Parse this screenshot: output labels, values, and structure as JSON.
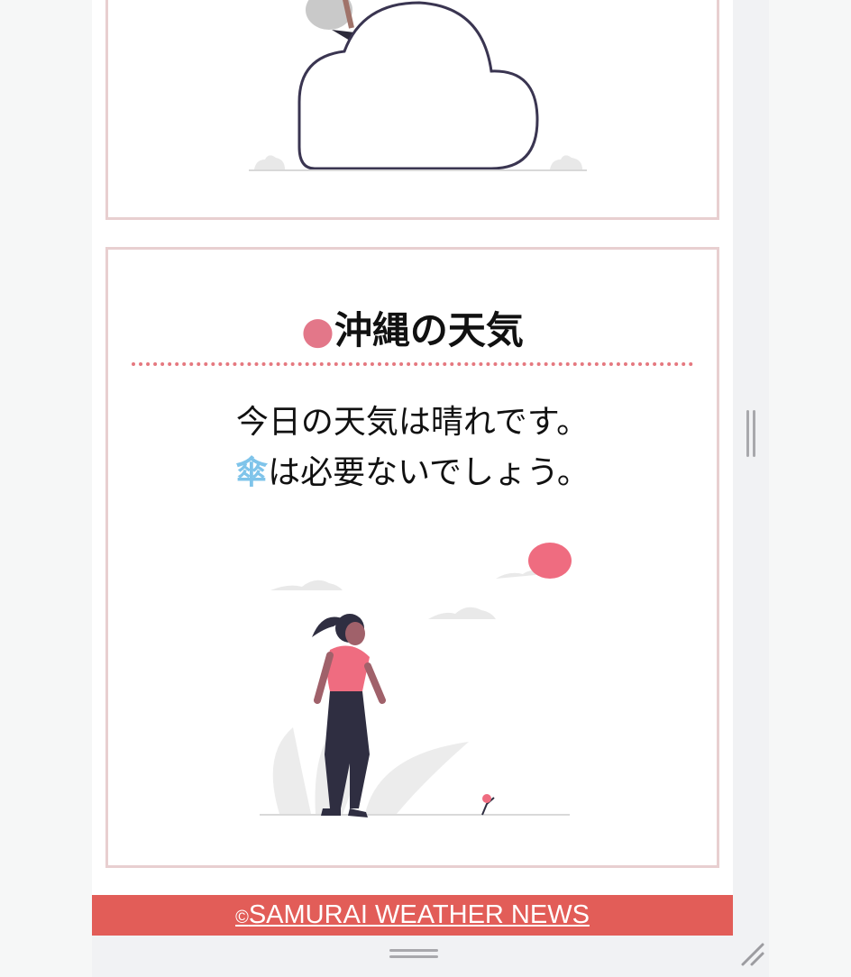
{
  "cards": [
    {
      "id": "previous-region",
      "illustration": "person-standing-on-cloud"
    },
    {
      "id": "okinawa",
      "title_marker": "●",
      "title": "沖縄の天気",
      "forecast_line": "今日の天気は晴れです。",
      "umbrella_glyph": "傘",
      "umbrella_text": "は必要ないでしょう。",
      "illustration": "woman-looking-at-sun"
    }
  ],
  "footer": {
    "copyright_symbol": "©",
    "link_text": "SAMURAI WEATHER NEWS"
  },
  "colors": {
    "card_border": "#e8cfd0",
    "title_marker": "#e37789",
    "dotted_rule": "#e5787f",
    "umbrella": "#7fc4ea",
    "footer_bg": "#e25d58",
    "sun": "#ef6c80"
  }
}
